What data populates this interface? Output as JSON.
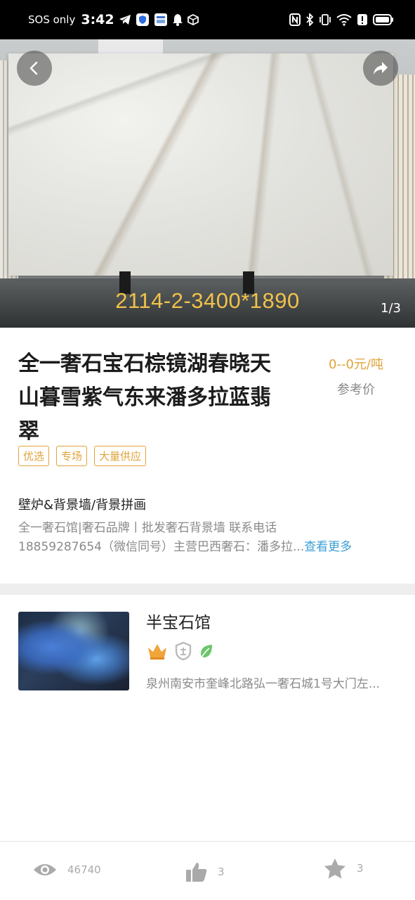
{
  "status_bar": {
    "carrier": "SOS only",
    "time": "3:42"
  },
  "hero": {
    "slab_code": "2114-2-3400*1890",
    "image_counter": "1/3"
  },
  "product": {
    "title_lines": [
      "全一奢石宝石棕镜湖春晓天",
      "山暮雪紫气东来潘多拉蓝翡",
      "翠"
    ],
    "price": "0--0元/吨",
    "price_label": "参考价",
    "tags": [
      "优选",
      "专场",
      "大量供应"
    ],
    "category": "壁炉&背景墙/背景拼画",
    "description_line1": "全一奢石馆|奢石品牌丨批发奢石背景墙 联系电话",
    "description_line2": "18859287654（微信同号）主营巴西奢石：潘多拉...",
    "see_more": "查看更多"
  },
  "shop": {
    "name": "半宝石馆",
    "badge_icons": [
      "crown-icon",
      "enterprise-shield-icon",
      "leaf-icon"
    ],
    "address": "泉州南安市奎峰北路弘一奢石城1号大门左..."
  },
  "bottom_bar": {
    "views": "46740",
    "likes": "3",
    "favorites": "3"
  },
  "colors": {
    "accent_gold": "#e0a43a",
    "link_blue": "#3d9fd6",
    "muted_text": "#8a8a8a"
  }
}
